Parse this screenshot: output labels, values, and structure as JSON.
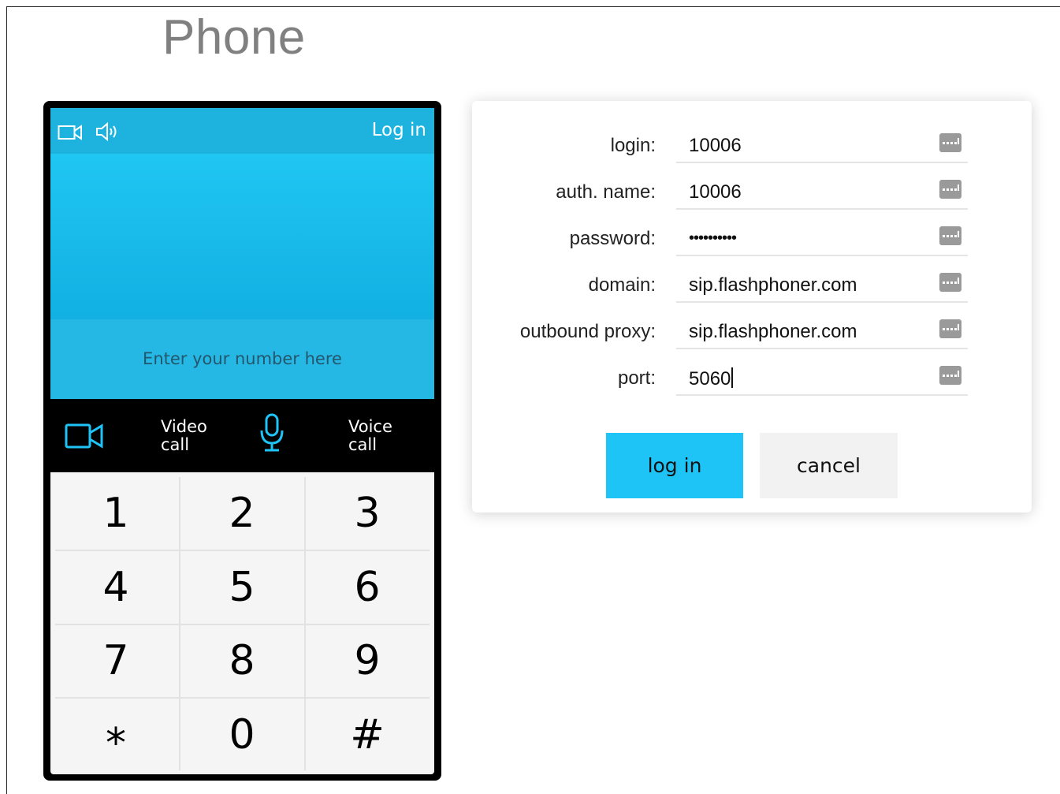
{
  "page": {
    "title": "Phone"
  },
  "phone": {
    "login_link": "Log in",
    "number_placeholder": "Enter your number here",
    "video_call": {
      "line1": "Video",
      "line2": "call"
    },
    "voice_call": {
      "line1": "Voice",
      "line2": "call"
    },
    "keys": [
      "1",
      "2",
      "3",
      "4",
      "5",
      "6",
      "7",
      "8",
      "9",
      "*",
      "0",
      "#"
    ],
    "icons": [
      "camera-icon",
      "speaker-icon",
      "video-call-icon",
      "microphone-icon"
    ],
    "colors": {
      "topbar": "#1eb3de",
      "display": "#20c6f2",
      "keypad": "#f5f5f5"
    }
  },
  "login_form": {
    "fields": [
      {
        "label": "login:",
        "value": "10006"
      },
      {
        "label": "auth. name:",
        "value": "10006"
      },
      {
        "label": "password:",
        "value": "••••••••••"
      },
      {
        "label": "domain:",
        "value": "sip.flashphoner.com"
      },
      {
        "label": "outbound proxy:",
        "value": "sip.flashphoner.com"
      },
      {
        "label": "port:",
        "value": "5060"
      }
    ],
    "login_button": "log in",
    "cancel_button": "cancel",
    "colors": {
      "login_button": "#1fc4f7",
      "cancel_button": "#f2f2f2"
    }
  }
}
